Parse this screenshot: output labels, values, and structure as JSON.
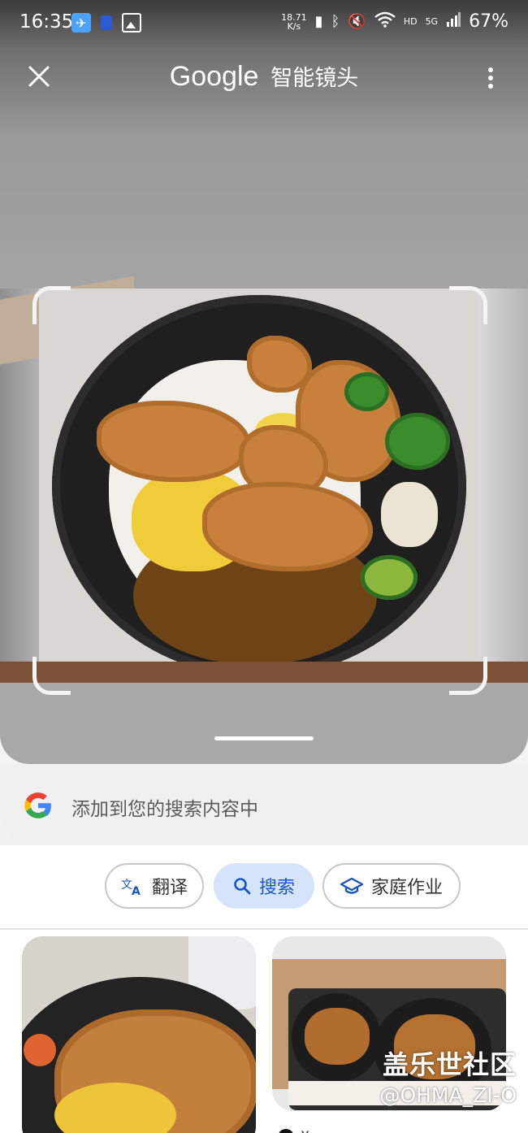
{
  "status_bar": {
    "time": "16:35",
    "net_speed": "18.71\nK/s",
    "signal_label": "HD",
    "network": "5G",
    "battery": "67%"
  },
  "app_bar": {
    "title_brand": "Google",
    "title_product": "智能镜头",
    "close_icon": "close-icon",
    "more_icon": "more-vert-icon"
  },
  "add_to_search": {
    "label": "添加到您的搜索内容中"
  },
  "chips": [
    {
      "label": "翻译",
      "icon": "translate-icon",
      "selected": false
    },
    {
      "label": "搜索",
      "icon": "search-icon",
      "selected": true
    },
    {
      "label": "家庭作业",
      "icon": "school-icon",
      "selected": false
    }
  ],
  "results": [
    {
      "source": ""
    },
    {
      "source": "X"
    }
  ],
  "watermark": {
    "line1": "盖乐世社区",
    "line2": "@OHMA_ZI-O"
  },
  "colors": {
    "accent": "#1a56c4",
    "chip_selected_bg": "#d5e3fb"
  }
}
